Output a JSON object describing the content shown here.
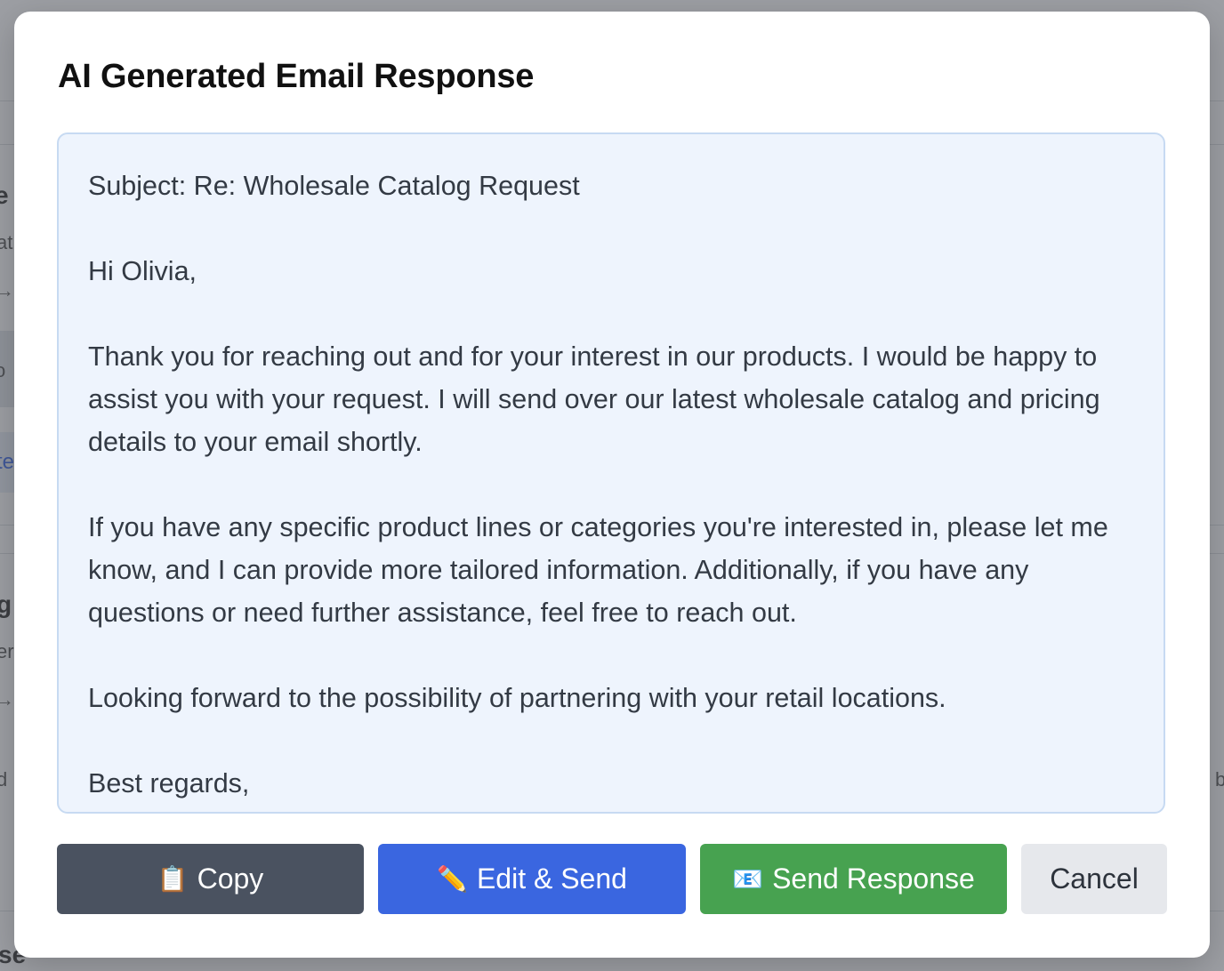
{
  "modal": {
    "title": "AI Generated Email Response",
    "email_body": "Subject: Re: Wholesale Catalog Request\n\nHi Olivia,\n\nThank you for reaching out and for your interest in our products. I would be happy to assist you with your request. I will send over our latest wholesale catalog and pricing details to your email shortly.\n\nIf you have any specific product lines or categories you're interested in, please let me know, and I can provide more tailored information. Additionally, if you have any questions or need further assistance, feel free to reach out.\n\nLooking forward to the possibility of partnering with your retail locations.\n\nBest regards,"
  },
  "buttons": {
    "copy": {
      "icon": "📋",
      "icon_name": "clipboard-icon",
      "label": "Copy",
      "color": "#4a5260"
    },
    "edit_send": {
      "icon": "✏️",
      "icon_name": "pencil-icon",
      "label": "Edit & Send",
      "color": "#3a66e0"
    },
    "send_response": {
      "icon": "📧",
      "icon_name": "email-icon",
      "label": "Send Response",
      "color": "#47a250"
    },
    "cancel": {
      "label": "Cancel",
      "color": "#e6e8ec"
    }
  },
  "background": {
    "fragments": [
      "e",
      "at",
      "→",
      "o",
      "te",
      "g",
      "er",
      "→",
      "d",
      "b",
      "se"
    ]
  }
}
